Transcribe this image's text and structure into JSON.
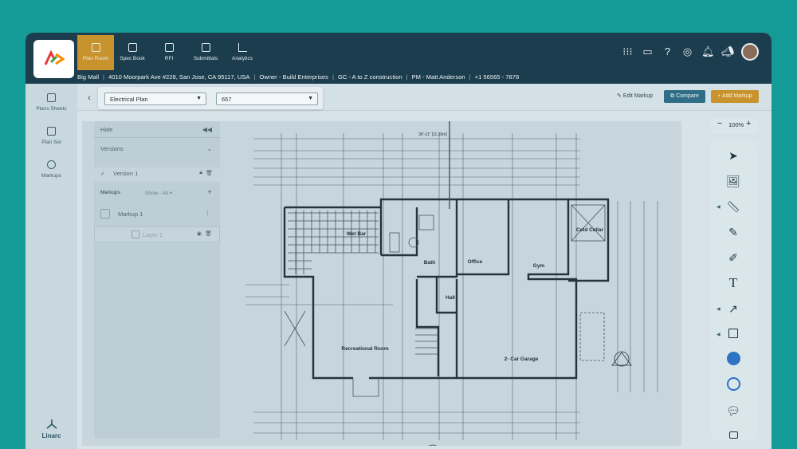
{
  "nav": {
    "tabs": [
      {
        "label": "Plan Room",
        "icon": "plan-room-icon",
        "active": true
      },
      {
        "label": "Spec Book",
        "icon": "spec-book-icon",
        "active": false
      },
      {
        "label": "RFI",
        "icon": "rfi-icon",
        "active": false
      },
      {
        "label": "Submittals",
        "icon": "submittals-icon",
        "active": false
      },
      {
        "label": "Analytics",
        "icon": "analytics-icon",
        "active": false
      }
    ]
  },
  "project": {
    "name": "Big Mall",
    "address": "4010 Moorpark Ave #228, San Jose, CA 95117, USA",
    "owner": "Owner - Build Enterprises",
    "gc": "GC - A to Z construction",
    "pm": "PM - Matt Anderson",
    "phone": "+1 56565 - 7878"
  },
  "rail": {
    "items": [
      {
        "label": "Plans Sheets",
        "icon": "plans-sheets-icon"
      },
      {
        "label": "Plan Set",
        "icon": "plan-set-icon"
      },
      {
        "label": "Markups",
        "icon": "markups-icon"
      }
    ],
    "brand": "Linarc"
  },
  "toolbar": {
    "plan_select": "Electrical Plan",
    "sheet_select": "657",
    "edit_markup": "Edit Markup",
    "compare": "Compare",
    "add_markup": "Add Markup"
  },
  "panel": {
    "hide": "Hide",
    "versions": "Versions",
    "version_item": "Version 1",
    "markups_label": "Markups",
    "show_filter": "Show - All",
    "markup_item": "Markup 1",
    "layer_item": "Layer 1"
  },
  "zoom": {
    "level": "100%"
  },
  "plan": {
    "rooms": [
      "Wet Bar",
      "Bath",
      "Office",
      "Gym",
      "Cold Cellar",
      "Hall",
      "Recreational Room",
      "2- Car Garage"
    ],
    "top_dimension": "36'-11\" [11.26m]"
  },
  "colors": {
    "brand_teal": "#149a97",
    "header": "#1b3d4e",
    "accent_gold": "#c8922c",
    "compare_blue": "#2f6e86",
    "tool_blue": "#2d74c4"
  }
}
